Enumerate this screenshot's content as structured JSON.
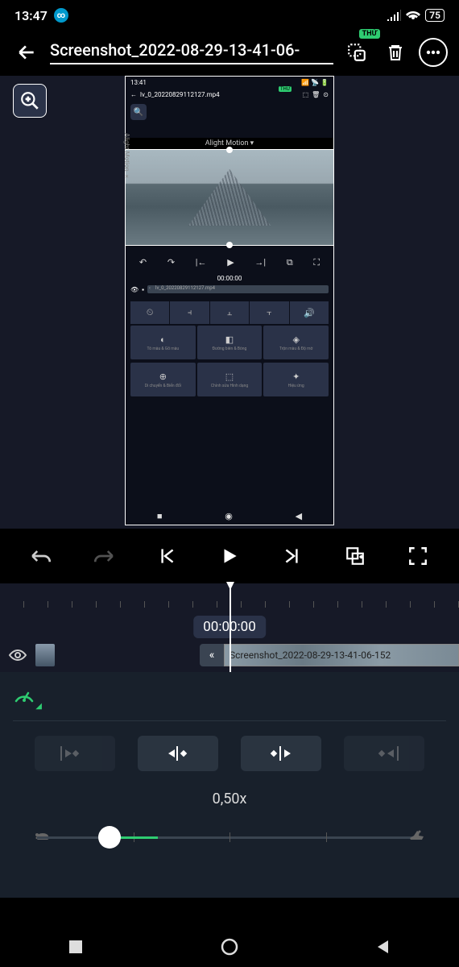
{
  "status": {
    "time": "13:47",
    "app_indicator": "∞",
    "battery": "75"
  },
  "toolbar": {
    "title": "Screenshot_2022-08-29-13-41-06-",
    "badge": "THỬ"
  },
  "nested": {
    "time": "13:41",
    "filename": "lv_0_20220829112127.mp4",
    "badge": "THỬ",
    "watermark": "Alight Motion ▾",
    "side_text": "Alight Motion ×",
    "playhead_time": "00:00:00",
    "clip_label": "lv_0_20220829112127.mp4",
    "cards": {
      "r1": [
        {
          "icon": "◐",
          "label": "Tô màu & Gõ màu"
        },
        {
          "icon": "◧",
          "label": "Đường biên & Bóng"
        },
        {
          "icon": "◈",
          "label": "Trộn màu & Độ mờ"
        }
      ],
      "r2": [
        {
          "icon": "⊕",
          "label": "Di chuyển & Biến đổi"
        },
        {
          "icon": "⬚",
          "label": "Chỉnh sửa Hình dạng"
        },
        {
          "icon": "✦",
          "label": "Hiệu ứng"
        }
      ]
    }
  },
  "timeline": {
    "time": "00:00:00",
    "clip_name": "Screenshot_2022-08-29-13-41-06-152"
  },
  "speed": {
    "value": "0,50x"
  }
}
